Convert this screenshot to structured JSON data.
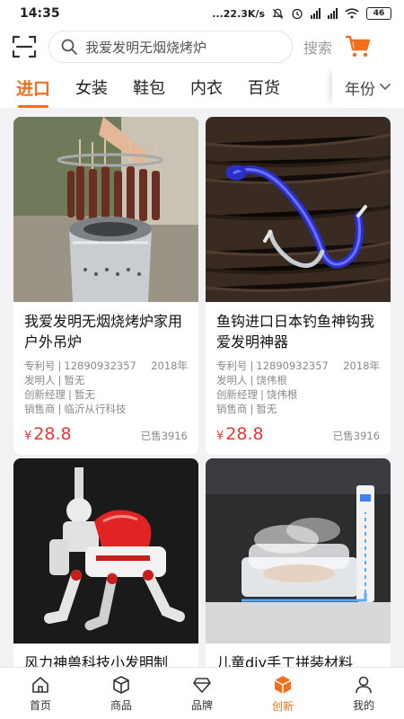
{
  "status": {
    "time": "14:35",
    "net_speed": "...22.3K/s",
    "battery": "46"
  },
  "search": {
    "placeholder": "我爱发明无烟烧烤炉",
    "button": "搜索"
  },
  "tabs": {
    "items": [
      "进口",
      "女装",
      "鞋包",
      "内衣",
      "百货"
    ],
    "year": "年份"
  },
  "products": [
    {
      "title": "我爱发明无烟烧烤炉家用户外吊炉",
      "patent_label": "专利号",
      "patent_no": "12890932357",
      "year": "2018年",
      "inventor_label": "发明人",
      "inventor": "暂无",
      "manager_label": "创新经理",
      "manager": "暂无",
      "seller_label": "销售商",
      "seller": "临沂从行科技",
      "currency": "¥",
      "price": "28.8",
      "sold": "已售3916"
    },
    {
      "title": "鱼钩进口日本钓鱼神钩我爱发明神器",
      "patent_label": "专利号",
      "patent_no": "12890932357",
      "year": "2018年",
      "inventor_label": "发明人",
      "inventor": "饶伟根",
      "manager_label": "创新经理",
      "manager": "饶伟根",
      "seller_label": "销售商",
      "seller": "暂无",
      "currency": "¥",
      "price": "28.8",
      "sold": "已售3916"
    },
    {
      "title": "风力神兽科技小发明制"
    },
    {
      "title": "儿童diy手工拼装材料"
    }
  ],
  "tabbar": {
    "items": [
      "首页",
      "商品",
      "品牌",
      "创新",
      "我的"
    ],
    "active": "创新"
  },
  "colors": {
    "accent": "#f0701e",
    "price": "#e8383a",
    "background": "#f2f2f4"
  }
}
